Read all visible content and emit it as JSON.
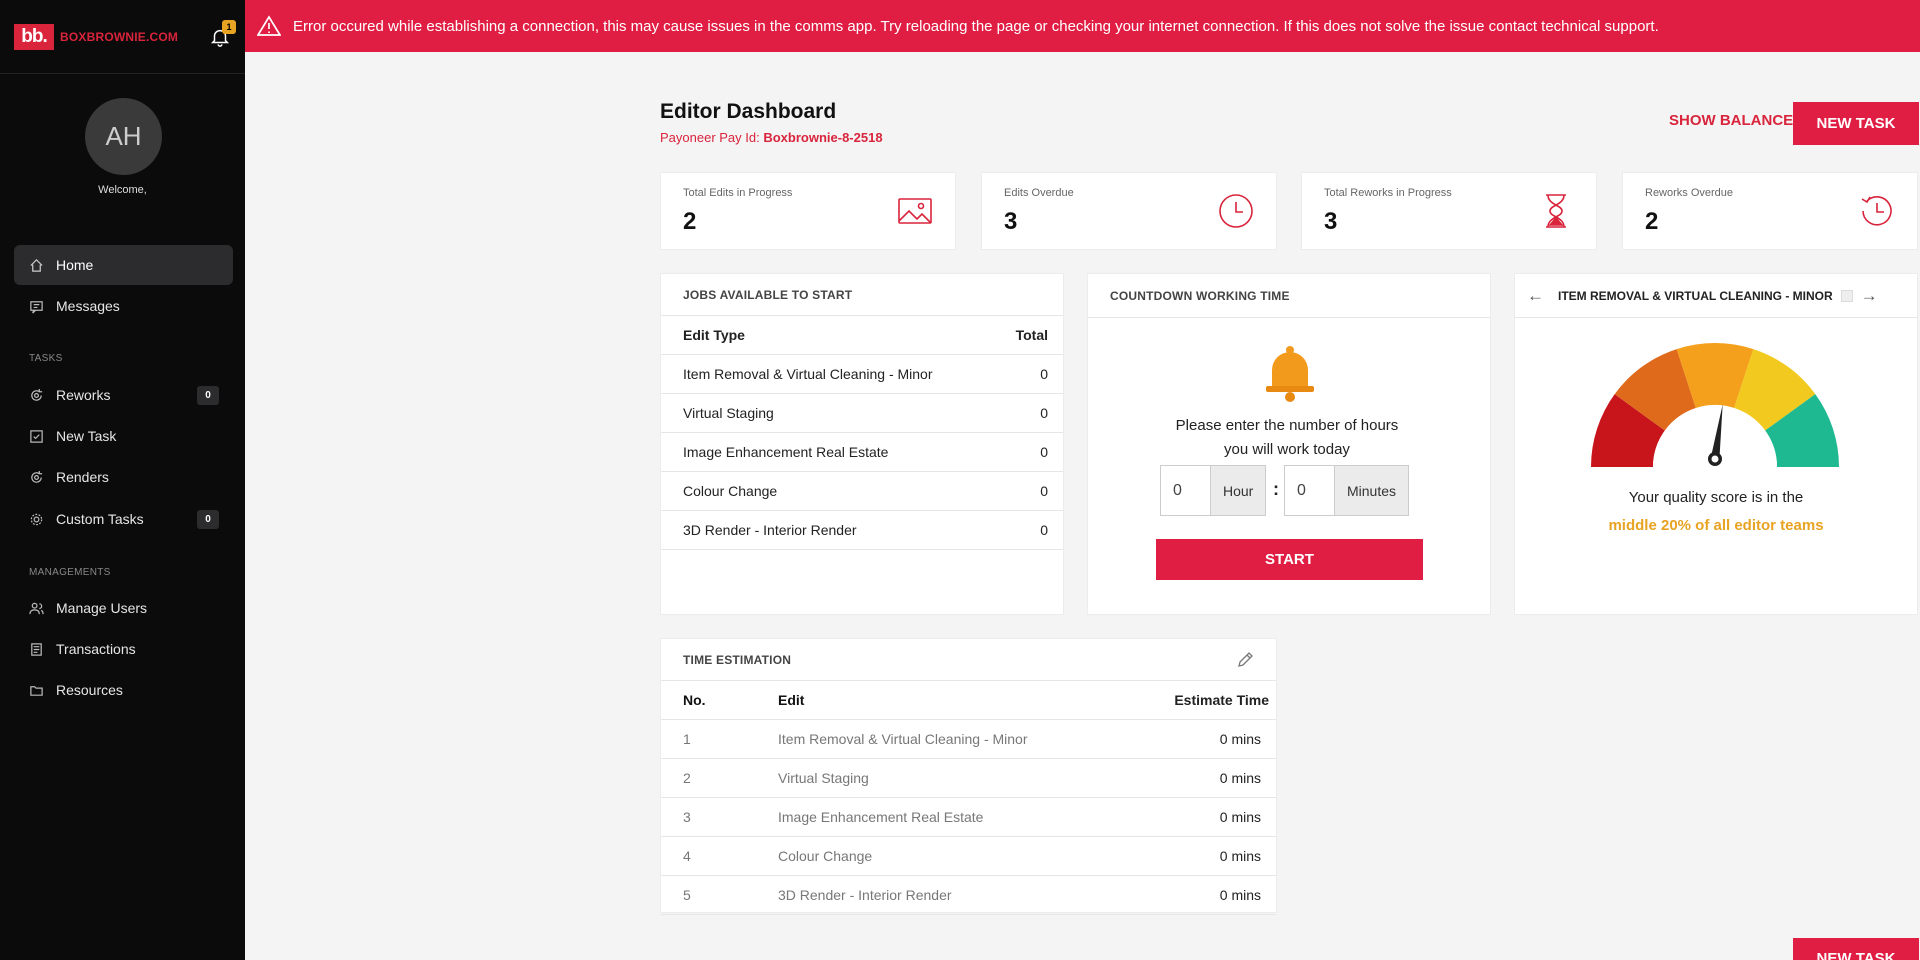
{
  "brand": {
    "logo_mark": "bb.",
    "logo_text": "BOXBROWNIE.COM",
    "notification_count": "1"
  },
  "user": {
    "initials": "AH",
    "welcome": "Welcome,"
  },
  "sidebar": {
    "items": [
      {
        "label": "Home",
        "icon": "home-icon"
      },
      {
        "label": "Messages",
        "icon": "message-icon"
      },
      {
        "label": "Reworks",
        "icon": "rework-icon",
        "count": "0"
      },
      {
        "label": "New Task",
        "icon": "new-task-icon"
      },
      {
        "label": "Renders",
        "icon": "render-icon"
      },
      {
        "label": "Custom Tasks",
        "icon": "gear-icon",
        "count": "0"
      },
      {
        "label": "Manage Users",
        "icon": "users-icon"
      },
      {
        "label": "Transactions",
        "icon": "transactions-icon"
      },
      {
        "label": "Resources",
        "icon": "folder-icon"
      }
    ],
    "sections": {
      "tasks": "TASKS",
      "managements": "MANAGEMENTS"
    }
  },
  "banner": {
    "message": "Error occured while establishing a connection, this may cause issues in the comms app. Try reloading the page or checking your internet connection. If this does not solve the issue contact technical support."
  },
  "header": {
    "title": "Editor Dashboard",
    "pay_id_label": "Payoneer Pay Id: ",
    "pay_id_value": "Boxbrownie-8-2518",
    "show_balance": "SHOW BALANCE",
    "new_task": "NEW TASK"
  },
  "stats": [
    {
      "label": "Total Edits in Progress",
      "value": "2",
      "icon": "image-icon"
    },
    {
      "label": "Edits Overdue",
      "value": "3",
      "icon": "clock-icon"
    },
    {
      "label": "Total Reworks in Progress",
      "value": "3",
      "icon": "hourglass-icon"
    },
    {
      "label": "Reworks Overdue",
      "value": "2",
      "icon": "history-icon"
    }
  ],
  "jobs": {
    "title": "JOBS AVAILABLE TO START",
    "col_type": "Edit Type",
    "col_total": "Total",
    "rows": [
      {
        "type": "Item Removal & Virtual Cleaning - Minor",
        "total": "0"
      },
      {
        "type": "Virtual Staging",
        "total": "0"
      },
      {
        "type": "Image Enhancement Real Estate",
        "total": "0"
      },
      {
        "type": "Colour Change",
        "total": "0"
      },
      {
        "type": "3D Render - Interior Render",
        "total": "0"
      }
    ]
  },
  "countdown": {
    "title": "COUNTDOWN WORKING TIME",
    "prompt_line1": "Please enter the number of hours",
    "prompt_line2": "you will work today",
    "hours_value": "0",
    "hours_unit": "Hour",
    "separator": ":",
    "minutes_value": "0",
    "minutes_unit": "Minutes",
    "start": "START"
  },
  "quality": {
    "title": "ITEM REMOVAL & VIRTUAL CLEANING - MINOR",
    "score_text": "Your quality score is in the",
    "score_highlight": "middle 20% of all editor teams",
    "gauge_colors": [
      "#c8151b",
      "#e06a1b",
      "#f4a01c",
      "#f2c91e",
      "#1fb991"
    ],
    "needle_level": 0.5
  },
  "time_estimation": {
    "title": "TIME ESTIMATION",
    "col_no": "No.",
    "col_edit": "Edit",
    "col_time": "Estimate Time",
    "rows": [
      {
        "no": "1",
        "edit": "Item Removal & Virtual Cleaning - Minor",
        "time": "0 mins"
      },
      {
        "no": "2",
        "edit": "Virtual Staging",
        "time": "0 mins"
      },
      {
        "no": "3",
        "edit": "Image Enhancement Real Estate",
        "time": "0 mins"
      },
      {
        "no": "4",
        "edit": "Colour Change",
        "time": "0 mins"
      },
      {
        "no": "5",
        "edit": "3D Render - Interior Render",
        "time": "0 mins"
      }
    ]
  },
  "colors": {
    "accent": "#e01e44",
    "sidebar_bg": "#0b0b0b",
    "highlight": "#e8a323"
  }
}
